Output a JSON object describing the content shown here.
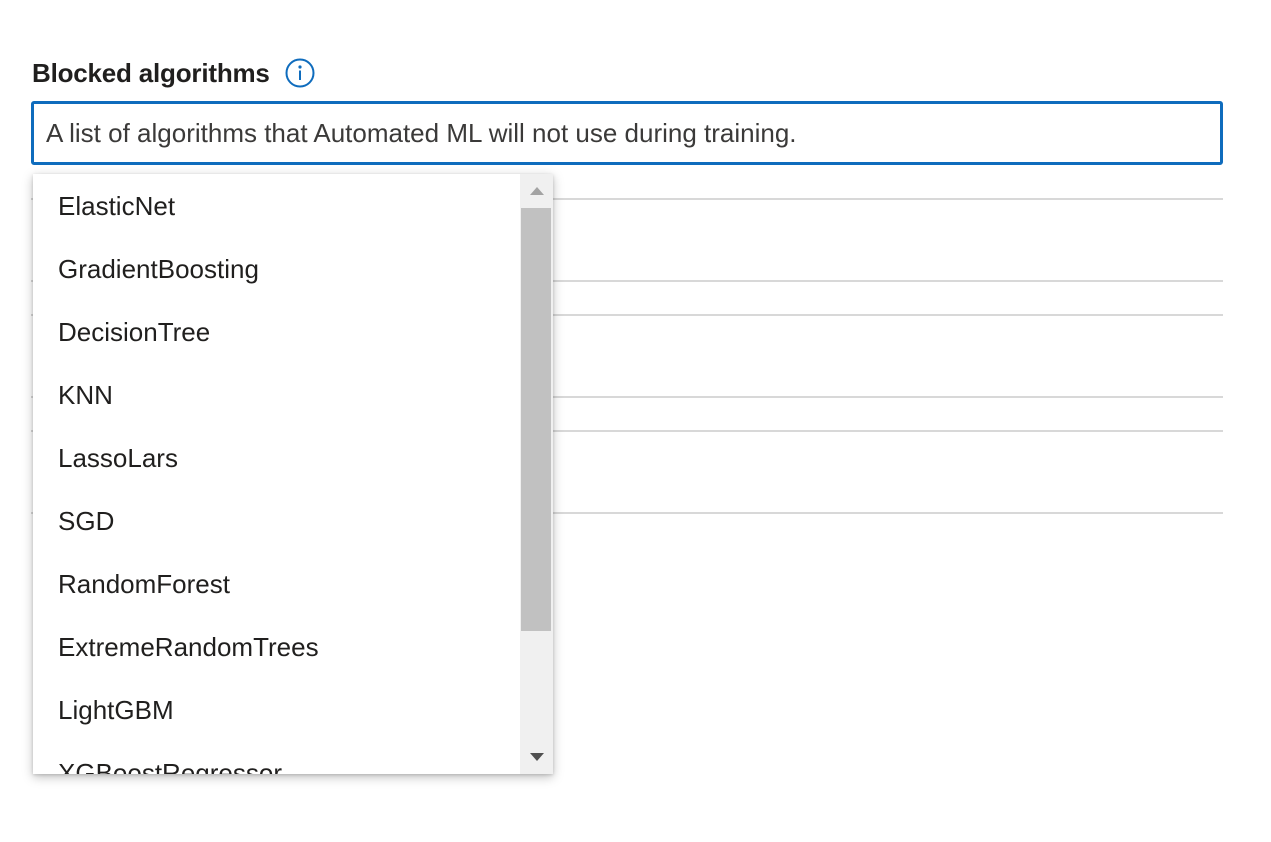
{
  "field": {
    "label": "Blocked algorithms",
    "info_icon": "info-icon",
    "placeholder": "A list of algorithms that Automated ML will not use during training."
  },
  "dropdown": {
    "options": [
      "ElasticNet",
      "GradientBoosting",
      "DecisionTree",
      "KNN",
      "LassoLars",
      "SGD",
      "RandomForest",
      "ExtremeRandomTrees",
      "LightGBM",
      "XGBoostRegressor"
    ],
    "scroll_up_icon": "triangle-up-icon",
    "scroll_down_icon": "triangle-down-icon"
  },
  "colors": {
    "focus_border": "#0f6cbd",
    "info_icon": "#0f6cbd",
    "scrollbar_track": "#f0f0f0",
    "scrollbar_thumb": "#c1c1c1",
    "divider": "#d8d8d8"
  }
}
